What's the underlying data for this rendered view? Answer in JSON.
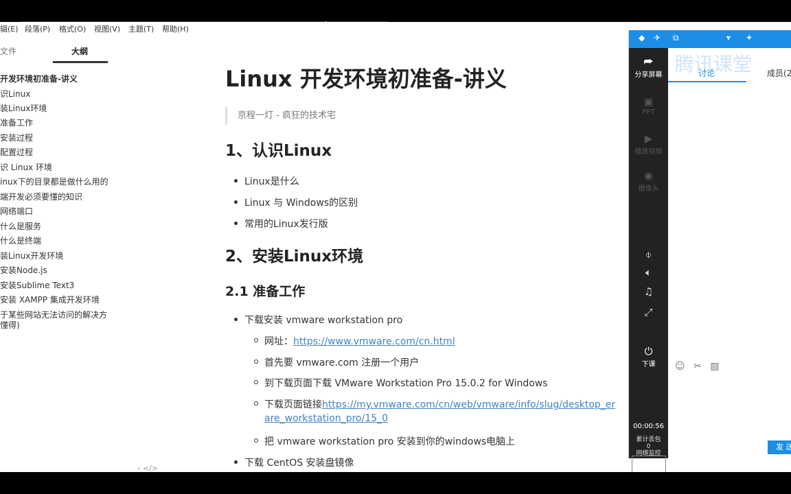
{
  "menu": [
    "辑(E)",
    "段落(P)",
    "格式(O)",
    "视图(V)",
    "主题(T)",
    "帮助(H)"
  ],
  "sidebar": {
    "tabs": [
      "文件",
      "大纲"
    ],
    "outline": [
      "开发环境初准备-讲义",
      "识Linux",
      "装Linux环境",
      "准备工作",
      "安装过程",
      "配置过程",
      "识 Linux 环境",
      "inux下的目录都是做什么用的",
      "端开发必须要懂的知识",
      "网络端口",
      "什么是服务",
      "什么是终端",
      "装Linux开发环境",
      "安装Node.js",
      "安装Sublime Text3",
      "安装 XAMPP 集成开发环境",
      "于某些网站无法访问的解决方",
      "懂得)"
    ]
  },
  "doc": {
    "title": "Linux 开发环境初准备-讲义",
    "quote": "京程一灯 - 疯狂的技术宅",
    "h2_1": "1、认识Linux",
    "list1": [
      "Linux是什么",
      "Linux 与 Windows的区别",
      "常用的Linux发行版"
    ],
    "h2_2": "2、安装Linux环境",
    "h3_1": "2.1 准备工作",
    "item_download": "下载安装 vmware workstation pro",
    "url_label": "网址：",
    "url": "https://www.vmware.com/cn.html",
    "sub_register": "首先要 vmware.com 注册一个用户",
    "sub_download": "到下载页面下载  VMware Workstation Pro 15.0.2 for Windows",
    "sub_link_label": "下载页面链接",
    "sub_link_1": "https://my.vmware.com/cn/web/vmware/info/slug/desktop_end_user_computing/vmware_workstation_pro/15_0",
    "sub_link_1_visible": "https://my.vmware.com/cn/web/vmware/info/slug/desktop_er",
    "sub_link_2_visible": "are_workstation_pro/15_0",
    "sub_install": "把 vmware workstation pro 安装到你的windows电脑上",
    "item_centos": "下载 CentOS 安装盘镜像"
  },
  "footer_nav": "‹  </>",
  "panel": {
    "brand": "腾讯课堂",
    "rail": [
      "分享屏幕",
      "PPT",
      "播放视频",
      "摄像头",
      "下课"
    ],
    "chat_tabs": [
      "讨论",
      "成员(2"
    ],
    "timer": "00:00:56",
    "stats": [
      "累计丢包",
      "0",
      "网络监控"
    ],
    "send": "发 送"
  }
}
